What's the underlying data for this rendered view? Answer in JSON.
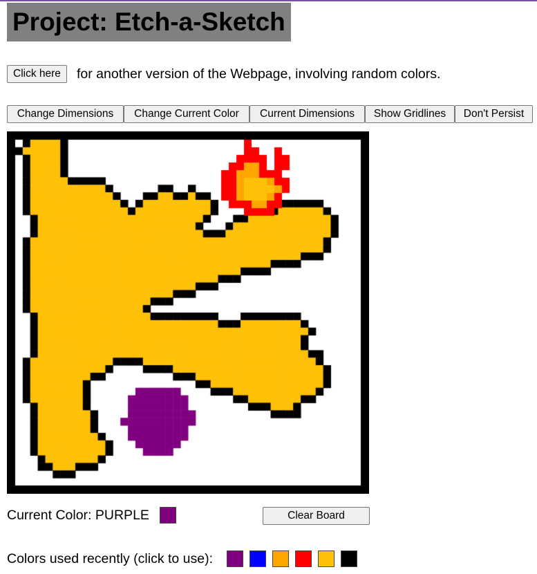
{
  "header": {
    "title": "Project: Etch-a-Sketch"
  },
  "intro": {
    "button_label": "Click here",
    "text": "for another version of the Webpage, involving random colors."
  },
  "toolbar": {
    "buttons": [
      "Change Dimensions",
      "Change Current Color",
      "Current Dimensions",
      "Show Gridlines",
      "Don't Persist"
    ]
  },
  "board": {
    "grid_size": 46,
    "background": "#ffffff",
    "colors": {
      "black": "#000000",
      "gold": "#ffc107",
      "purple": "#800080",
      "red": "#ff0000",
      "orange": "#ffa500"
    }
  },
  "status": {
    "current_color_label": "Current Color:",
    "current_color_name": "PURPLE",
    "current_color_hex": "#800080",
    "clear_button_label": "Clear Board"
  },
  "recent": {
    "label": "Colors used recently (click to use):",
    "colors": [
      {
        "name": "purple",
        "hex": "#800080"
      },
      {
        "name": "blue",
        "hex": "#0000ff"
      },
      {
        "name": "orange",
        "hex": "#ffa500"
      },
      {
        "name": "red",
        "hex": "#ff0000"
      },
      {
        "name": "gold",
        "hex": "#ffc107"
      },
      {
        "name": "black",
        "hex": "#000000"
      }
    ]
  }
}
